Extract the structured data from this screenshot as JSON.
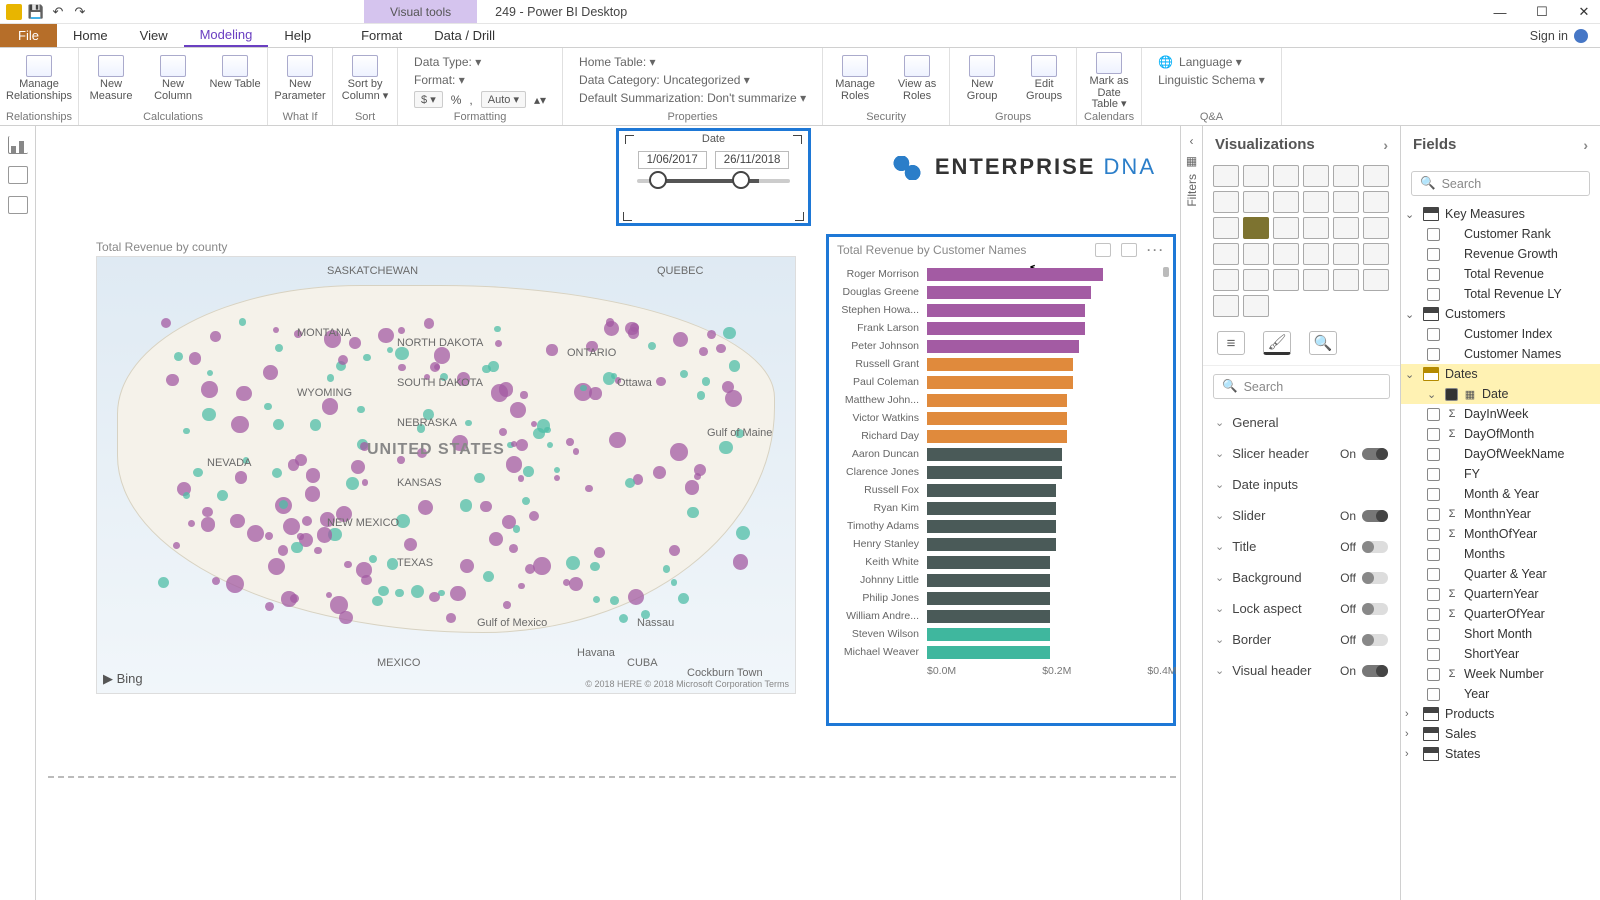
{
  "titlebar": {
    "visual_tools": "Visual tools",
    "doc_title": "249 - Power BI Desktop"
  },
  "menu": {
    "file": "File",
    "home": "Home",
    "view": "View",
    "modeling": "Modeling",
    "help": "Help",
    "format": "Format",
    "datadrill": "Data / Drill",
    "signin": "Sign in"
  },
  "ribbon": {
    "relationships": {
      "label": "Relationships",
      "manage": "Manage Relationships"
    },
    "calculations": {
      "label": "Calculations",
      "new_measure": "New Measure",
      "new_column": "New Column",
      "new_table": "New Table"
    },
    "whatif": {
      "label": "What If",
      "new_parameter": "New Parameter"
    },
    "sort": {
      "label": "Sort",
      "sort_by": "Sort by Column ▾"
    },
    "formatting": {
      "label": "Formatting",
      "currency": "$ ▾",
      "percent": "%",
      "comma": ",",
      "auto": "Auto ▾",
      "updn": "▴▾"
    },
    "properties": {
      "label": "Properties",
      "data_type": "Data Type: ▾",
      "format": "Format: ▾",
      "home_table": "Home Table: ▾",
      "data_category": "Data Category: Uncategorized ▾",
      "default_sum": "Default Summarization: Don't summarize ▾"
    },
    "security": {
      "label": "Security",
      "manage_roles": "Manage Roles",
      "view_as": "View as Roles"
    },
    "groups": {
      "label": "Groups",
      "new_group": "New Group",
      "edit_groups": "Edit Groups"
    },
    "calendars": {
      "label": "Calendars",
      "mark": "Mark as Date Table ▾"
    },
    "qa": {
      "label": "Q&A",
      "language": "Language ▾",
      "schema": "Linguistic Schema ▾"
    }
  },
  "slicer": {
    "field": "Date",
    "start": "1/06/2017",
    "end": "26/11/2018"
  },
  "logo": {
    "a": "ENTERPRISE",
    "b": "DNA"
  },
  "map": {
    "title": "Total Revenue by county",
    "big": "UNITED STATES",
    "labels": [
      "SASKATCHEWAN",
      "QUEBEC",
      "ONTARIO",
      "Ottawa",
      "Gulf of Maine",
      "Gulf of Mexico",
      "MEXICO",
      "Havana",
      "CUBA",
      "Nassau",
      "NEW MEXICO",
      "TEXAS",
      "MONTANA",
      "WYOMING",
      "NEVADA",
      "NORTH DAKOTA",
      "SOUTH DAKOTA",
      "NEBRASKA",
      "KANSAS",
      "Cockburn Town"
    ],
    "bing": "▶ Bing",
    "copy": "© 2018 HERE © 2018 Microsoft Corporation  Terms"
  },
  "chart_data": {
    "type": "bar",
    "title": "Total Revenue by Customer Names",
    "xlabel": "",
    "ylabel": "",
    "xlim": [
      0,
      0.4
    ],
    "xunit": "M",
    "axis_ticks": [
      "$0.0M",
      "$0.2M",
      "$0.4M"
    ],
    "series": [
      {
        "name": "Roger Morrison",
        "value": 0.3,
        "color": "#a35ba3"
      },
      {
        "name": "Douglas Greene",
        "value": 0.28,
        "color": "#a35ba3"
      },
      {
        "name": "Stephen Howa...",
        "value": 0.27,
        "color": "#a35ba3"
      },
      {
        "name": "Frank Larson",
        "value": 0.27,
        "color": "#a35ba3"
      },
      {
        "name": "Peter Johnson",
        "value": 0.26,
        "color": "#a35ba3"
      },
      {
        "name": "Russell Grant",
        "value": 0.25,
        "color": "#e08a3c"
      },
      {
        "name": "Paul Coleman",
        "value": 0.25,
        "color": "#e08a3c"
      },
      {
        "name": "Matthew John...",
        "value": 0.24,
        "color": "#e08a3c"
      },
      {
        "name": "Victor Watkins",
        "value": 0.24,
        "color": "#e08a3c"
      },
      {
        "name": "Richard Day",
        "value": 0.24,
        "color": "#e08a3c"
      },
      {
        "name": "Aaron Duncan",
        "value": 0.23,
        "color": "#4a5a58"
      },
      {
        "name": "Clarence Jones",
        "value": 0.23,
        "color": "#4a5a58"
      },
      {
        "name": "Russell Fox",
        "value": 0.22,
        "color": "#4a5a58"
      },
      {
        "name": "Ryan Kim",
        "value": 0.22,
        "color": "#4a5a58"
      },
      {
        "name": "Timothy Adams",
        "value": 0.22,
        "color": "#4a5a58"
      },
      {
        "name": "Henry Stanley",
        "value": 0.22,
        "color": "#4a5a58"
      },
      {
        "name": "Keith White",
        "value": 0.21,
        "color": "#4a5a58"
      },
      {
        "name": "Johnny Little",
        "value": 0.21,
        "color": "#4a5a58"
      },
      {
        "name": "Philip Jones",
        "value": 0.21,
        "color": "#4a5a58"
      },
      {
        "name": "William Andre...",
        "value": 0.21,
        "color": "#4a5a58"
      },
      {
        "name": "Steven Wilson",
        "value": 0.21,
        "color": "#3fb79e"
      },
      {
        "name": "Michael Weaver",
        "value": 0.21,
        "color": "#3fb79e"
      }
    ]
  },
  "vis_panel": {
    "title": "Visualizations",
    "search_placeholder": "Search",
    "format_rows": [
      {
        "label": "General",
        "toggle": null
      },
      {
        "label": "Slicer header",
        "toggle": "On"
      },
      {
        "label": "Date inputs",
        "toggle": null
      },
      {
        "label": "Slider",
        "toggle": "On"
      },
      {
        "label": "Title",
        "toggle": "Off"
      },
      {
        "label": "Background",
        "toggle": "Off"
      },
      {
        "label": "Lock aspect",
        "toggle": "Off"
      },
      {
        "label": "Border",
        "toggle": "Off"
      },
      {
        "label": "Visual header",
        "toggle": "On"
      }
    ]
  },
  "filters_label": "Filters",
  "fields_panel": {
    "title": "Fields",
    "search_placeholder": "Search",
    "tables": [
      {
        "name": "Key Measures",
        "expanded": true,
        "children": [
          {
            "name": "Customer Rank",
            "sig": "",
            "chk": false
          },
          {
            "name": "Revenue Growth",
            "sig": "",
            "chk": false
          },
          {
            "name": "Total Revenue",
            "sig": "",
            "chk": false
          },
          {
            "name": "Total Revenue LY",
            "sig": "",
            "chk": false
          }
        ]
      },
      {
        "name": "Customers",
        "expanded": true,
        "children": [
          {
            "name": "Customer Index",
            "sig": "",
            "chk": false
          },
          {
            "name": "Customer Names",
            "sig": "",
            "chk": false
          }
        ]
      },
      {
        "name": "Dates",
        "expanded": true,
        "selected": true,
        "children": [
          {
            "name": "Date",
            "sig": "▦",
            "chk": true,
            "sel": true
          },
          {
            "name": "DayInWeek",
            "sig": "Σ",
            "chk": false
          },
          {
            "name": "DayOfMonth",
            "sig": "Σ",
            "chk": false
          },
          {
            "name": "DayOfWeekName",
            "sig": "",
            "chk": false
          },
          {
            "name": "FY",
            "sig": "",
            "chk": false
          },
          {
            "name": "Month & Year",
            "sig": "",
            "chk": false
          },
          {
            "name": "MonthnYear",
            "sig": "Σ",
            "chk": false
          },
          {
            "name": "MonthOfYear",
            "sig": "Σ",
            "chk": false
          },
          {
            "name": "Months",
            "sig": "",
            "chk": false
          },
          {
            "name": "Quarter & Year",
            "sig": "",
            "chk": false
          },
          {
            "name": "QuarternYear",
            "sig": "Σ",
            "chk": false
          },
          {
            "name": "QuarterOfYear",
            "sig": "Σ",
            "chk": false
          },
          {
            "name": "Short Month",
            "sig": "",
            "chk": false
          },
          {
            "name": "ShortYear",
            "sig": "",
            "chk": false
          },
          {
            "name": "Week Number",
            "sig": "Σ",
            "chk": false
          },
          {
            "name": "Year",
            "sig": "",
            "chk": false
          }
        ]
      },
      {
        "name": "Products",
        "expanded": false
      },
      {
        "name": "Sales",
        "expanded": false
      },
      {
        "name": "States",
        "expanded": false
      }
    ]
  }
}
